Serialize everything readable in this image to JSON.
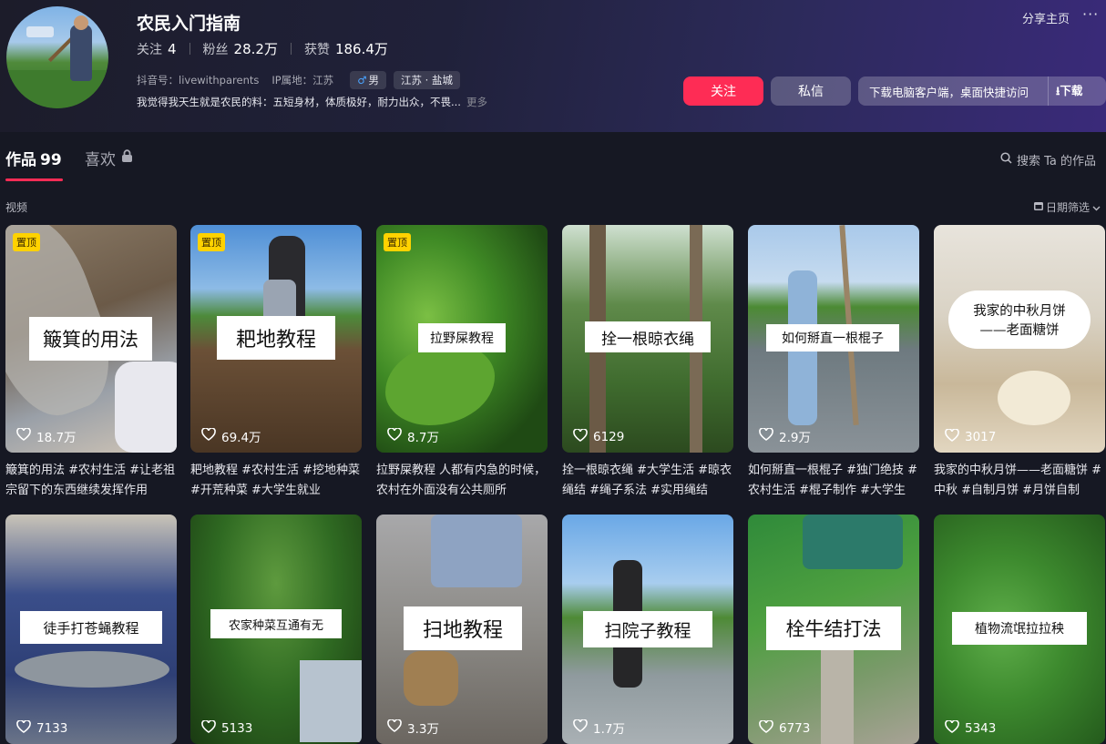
{
  "profile": {
    "name": "农民入门指南",
    "following_label": "关注",
    "following": "4",
    "followers_label": "粉丝",
    "followers": "28.2万",
    "likes_label": "获赞",
    "likes": "186.4万",
    "douyin_id": "抖音号：livewithparents",
    "ip": "IP属地：江苏",
    "gender_symbol": "♂",
    "gender": "男",
    "region": "江苏 · 盐城",
    "bio": "我觉得我天生就是农民的料：五短身材，体质极好，耐力出众，不畏...",
    "bio_more": "更多"
  },
  "topbar": {
    "share": "分享主页",
    "more": "···"
  },
  "actions": {
    "follow": "关注",
    "message": "私信",
    "download_tip": "下载电脑客户端，桌面快捷访问",
    "download": "⭳下载"
  },
  "tabs": {
    "works": "作品",
    "works_count": "99",
    "likes": "喜欢"
  },
  "search": {
    "label": "搜索 Ta 的作品"
  },
  "section": {
    "label": "视频",
    "date_filter": "日期筛选"
  },
  "colors": {
    "accent": "#fe2c55",
    "pin": "#ffd200",
    "background": "#161823"
  },
  "videos": [
    {
      "pinned": true,
      "pin_label": "置顶",
      "overlay": "簸箕的用法",
      "likes": "18.7万",
      "desc": "簸箕的用法 #农村生活 #让老祖宗留下的东西继续发挥作用"
    },
    {
      "pinned": true,
      "pin_label": "置顶",
      "overlay": "耙地教程",
      "likes": "69.4万",
      "desc": "耙地教程 #农村生活 #挖地种菜 #开荒种菜 #大学生就业"
    },
    {
      "pinned": true,
      "pin_label": "置顶",
      "overlay": "拉野屎教程",
      "likes": "8.7万",
      "desc": "拉野屎教程 人都有内急的时候，农村在外面没有公共厕所"
    },
    {
      "pinned": false,
      "overlay": "拴一根晾衣绳",
      "likes": "6129",
      "desc": "拴一根晾衣绳 #大学生活 #晾衣绳结 #绳子系法 #实用绳结"
    },
    {
      "pinned": false,
      "overlay": "如何掰直一根棍子",
      "likes": "2.9万",
      "desc": "如何掰直一根棍子 #独门绝技 #农村生活 #棍子制作 #大学生"
    },
    {
      "pinned": false,
      "overlay": "我家的中秋月饼",
      "overlay2": "——老面糖饼",
      "likes": "3017",
      "desc": "我家的中秋月饼——老面糖饼 #中秋 #自制月饼 #月饼自制"
    },
    {
      "pinned": false,
      "overlay": "徒手打苍蝇教程",
      "likes": "7133",
      "desc": ""
    },
    {
      "pinned": false,
      "overlay": "农家种菜互通有无",
      "likes": "5133",
      "desc": ""
    },
    {
      "pinned": false,
      "overlay": "扫地教程",
      "likes": "3.3万",
      "desc": ""
    },
    {
      "pinned": false,
      "overlay": "扫院子教程",
      "likes": "1.7万",
      "desc": ""
    },
    {
      "pinned": false,
      "overlay": "栓牛结打法",
      "likes": "6773",
      "desc": ""
    },
    {
      "pinned": false,
      "overlay": "植物流氓拉拉秧",
      "likes": "5343",
      "desc": ""
    }
  ]
}
